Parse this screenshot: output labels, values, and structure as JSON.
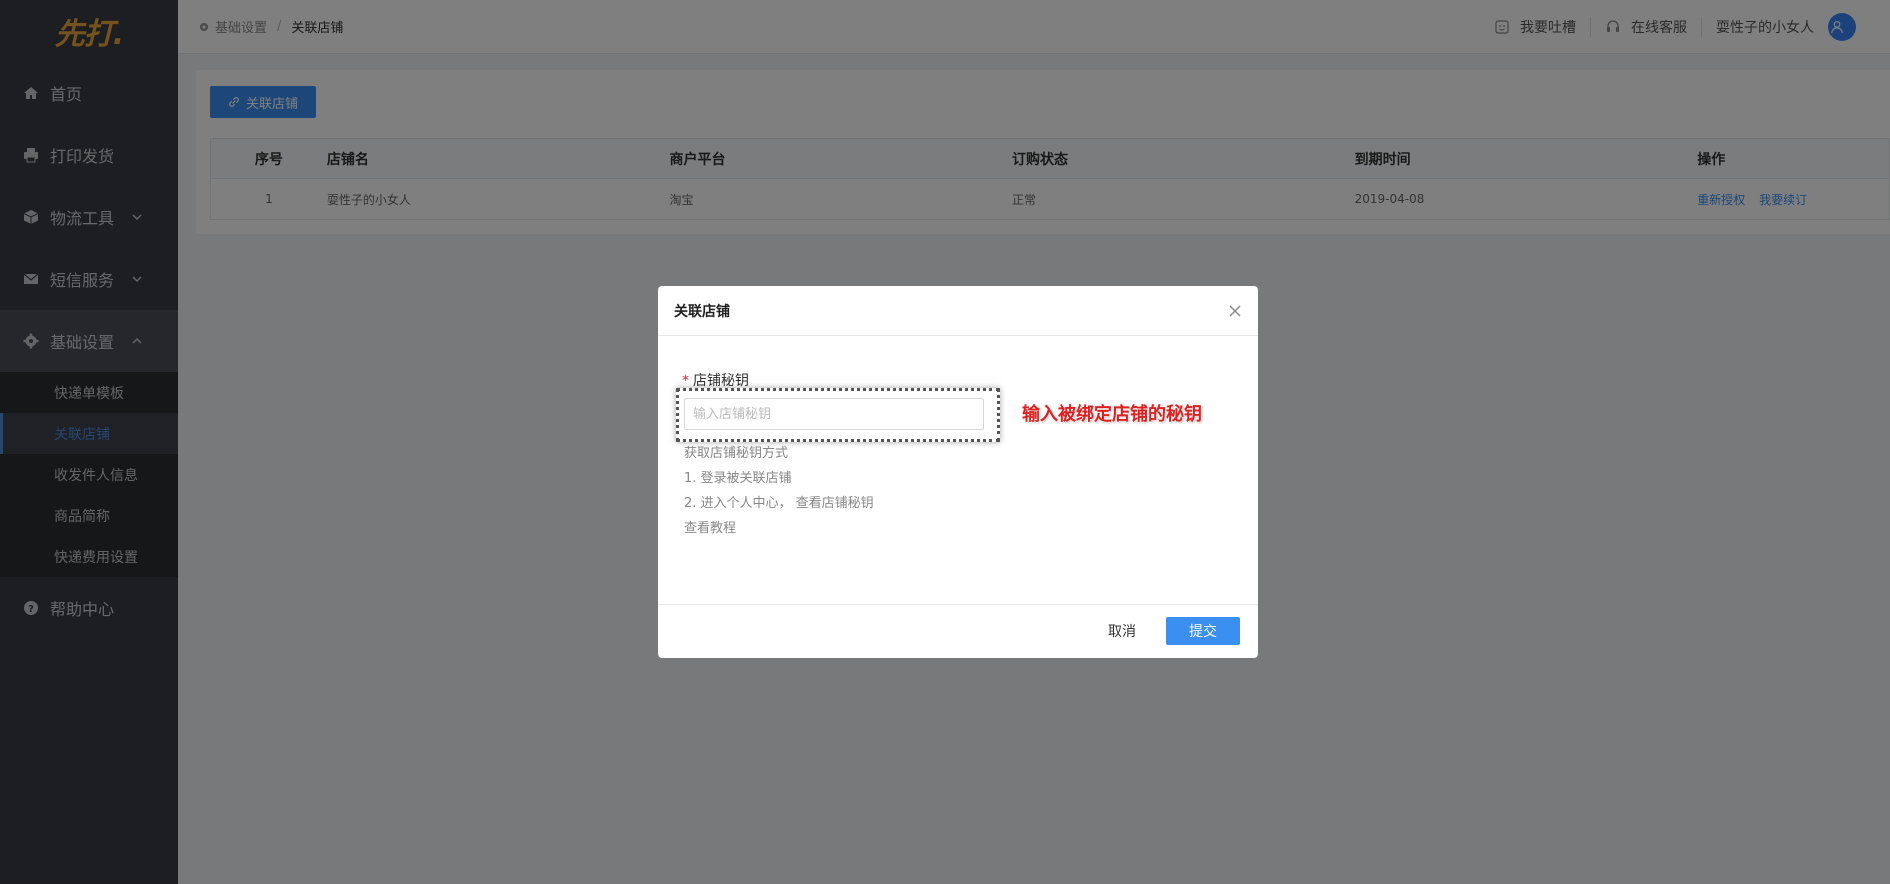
{
  "app": {
    "logo_text": "先打."
  },
  "sidebar": {
    "items": [
      {
        "label": "首页",
        "icon": "home-icon"
      },
      {
        "label": "打印发货",
        "icon": "printer-icon"
      },
      {
        "label": "物流工具",
        "icon": "box-icon"
      },
      {
        "label": "短信服务",
        "icon": "mail-icon"
      },
      {
        "label": "基础设置",
        "icon": "gear-icon"
      },
      {
        "label": "帮助中心",
        "icon": "help-icon"
      }
    ],
    "subitems": [
      "快递单模板",
      "关联店铺",
      "收发件人信息",
      "商品简称",
      "快递费用设置"
    ],
    "active_subitem": "关联店铺"
  },
  "header": {
    "breadcrumb": [
      "基础设置",
      "关联店铺"
    ],
    "feedback": "我要吐槽",
    "support": "在线客服",
    "username": "耍性子的小女人"
  },
  "toolbar": {
    "link_store_label": "关联店铺"
  },
  "table": {
    "columns": [
      "序号",
      "店铺名",
      "商户平台",
      "订购状态",
      "到期时间",
      "操作"
    ],
    "rows": [
      {
        "index": "1",
        "name": "耍性子的小女人",
        "platform": "淘宝",
        "status": "正常",
        "expire": "2019-04-08",
        "actions": [
          "重新授权",
          "我要续订"
        ]
      }
    ]
  },
  "modal": {
    "title": "关联店铺",
    "field_label": "店铺秘钥",
    "input_value": "",
    "input_placeholder": "输入店铺秘钥",
    "annotation": "输入被绑定店铺的秘钥",
    "help_lines": [
      "获取店铺秘钥方式",
      "1. 登录被关联店铺",
      "2. 进入个人中心， 查看店铺秘钥",
      "查看教程"
    ],
    "cancel_label": "取消",
    "submit_label": "提交"
  },
  "colors": {
    "accent": "#3b8ff0",
    "sidebar_bg": "#3a3d44",
    "logo": "#e8a63c",
    "annotation": "#e02020"
  }
}
